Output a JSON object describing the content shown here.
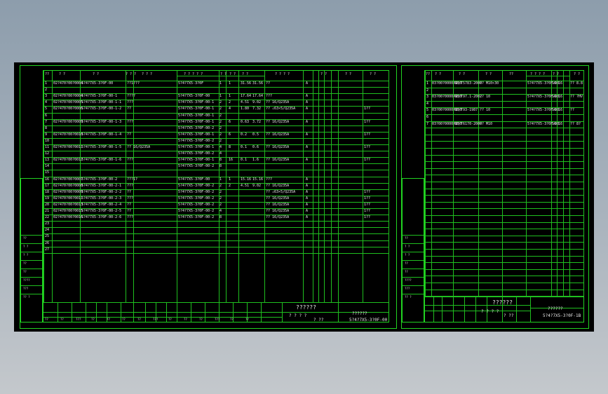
{
  "main": {
    "header": [
      "??",
      "? ?",
      "? ?",
      "? ? ?",
      "? ? ?",
      "? ? ? ? ?",
      "? ?",
      "? ?",
      "? ?",
      "? ? ? ?",
      "? ?",
      "? ?",
      "? ?"
    ],
    "subheader": [
      "? ?",
      "? ?",
      "??",
      "??",
      "??"
    ],
    "rows": [
      {
        "n": "1",
        "code": "02?470?00?0004",
        "name": "5?4?7X5-3?0F-00",
        "qty": "??1???",
        "sub": "5?4?7X5-3?0F",
        "a": "1",
        "b": "1",
        "w": "31.56",
        "tw": "31.56",
        "mat": "??",
        "z": "A",
        "r": ""
      },
      {
        "n": "2",
        "code": "",
        "name": "",
        "qty": "",
        "sub": "",
        "a": "",
        "b": "",
        "w": "",
        "tw": "",
        "mat": "",
        "z": "",
        "r": ""
      },
      {
        "n": "3",
        "code": "02?470?00?0004",
        "name": "5?4?7X5-3?0F-00-1",
        "qty": "????",
        "sub": "5?4?7X5-3?0F-00",
        "a": "1",
        "b": "1",
        "w": "17.64",
        "tw": "17.64",
        "mat": "???",
        "z": "A",
        "r": ""
      },
      {
        "n": "4",
        "code": "02?470?00?0005",
        "name": "5?4?7X5-3?0F-00-1-1",
        "qty": "???",
        "sub": "5?4?7X5-3?0F-00-1",
        "a": "2",
        "b": "2",
        "w": "4.51",
        "tw": "9.02",
        "mat": "?? 16/Q235A",
        "z": "A",
        "r": ""
      },
      {
        "n": "5",
        "code": "02?470?00?0006",
        "name": "5?4?7X5-3?0F-00-1-2",
        "qty": "??",
        "sub": "5?4?7X5-3?0F-00-1",
        "a": "2",
        "b": "4",
        "w": "1.80",
        "tw": "7.32",
        "mat": "?? ∠63×5/Q235A",
        "z": "A",
        "r": "1??"
      },
      {
        "n": "6",
        "code": "",
        "name": "",
        "qty": "",
        "sub": "5?4?7X5-3?0F-00-1",
        "a": "2",
        "b": "",
        "w": "",
        "tw": "",
        "mat": "",
        "z": "",
        "r": ""
      },
      {
        "n": "7",
        "code": "02?470?00?0009",
        "name": "5?4?7X5-3?0F-00-1-3",
        "qty": "???",
        "sub": "5?4?7X5-3?0F-00-1",
        "a": "2",
        "b": "6",
        "w": "0.63",
        "tw": "3.72",
        "mat": "?? 16/Q235A",
        "z": "A",
        "r": "1??"
      },
      {
        "n": "8",
        "code": "",
        "name": "",
        "qty": "",
        "sub": "5?4?7X5-3?0F-00-2",
        "a": "2",
        "b": "",
        "w": "",
        "tw": "",
        "mat": "",
        "z": "",
        "r": ""
      },
      {
        "n": "9",
        "code": "02?470?00?0010",
        "name": "5?4?7X5-3?0F-00-1-4",
        "qty": "??",
        "sub": "5?4?7X5-3?0F-00-1",
        "a": "2",
        "b": "6",
        "w": "0.2",
        "tw": "0.5",
        "mat": "?? 16/Q235A",
        "z": "A",
        "r": "1??"
      },
      {
        "n": "10",
        "code": "",
        "name": "",
        "qty": "",
        "sub": "5?4?7X5-3?0F-00-2",
        "a": "2",
        "b": "",
        "w": "",
        "tw": "",
        "mat": "",
        "z": "",
        "r": ""
      },
      {
        "n": "11",
        "code": "02?470?00?0011",
        "name": "5?4?7X5-3?0F-00-1-5",
        "qty": "?? 16/Q235A",
        "sub": "5?4?7X5-3?0F-00-1",
        "a": "4",
        "b": "8",
        "w": "0.1",
        "tw": "0.6",
        "mat": "?? 16/Q235A",
        "z": "A",
        "r": "1??"
      },
      {
        "n": "12",
        "code": "",
        "name": "",
        "qty": "",
        "sub": "5?4?7X5-3?0F-00-2",
        "a": "4",
        "b": "",
        "w": "",
        "tw": "",
        "mat": "",
        "z": "",
        "r": ""
      },
      {
        "n": "13",
        "code": "02?470?00?0012",
        "name": "5?4?7X5-3?0F-00-1-6",
        "qty": "???",
        "sub": "5?4?7X5-3?0F-00-1",
        "a": "8",
        "b": "16",
        "w": "0.1",
        "tw": "1.6",
        "mat": "?? 16/Q235A",
        "z": "A",
        "r": "1??"
      },
      {
        "n": "14",
        "code": "",
        "name": "",
        "qty": "",
        "sub": "5?4?7X5-3?0F-00-2",
        "a": "8",
        "b": "",
        "w": "",
        "tw": "",
        "mat": "",
        "z": "",
        "r": ""
      },
      {
        "n": "15",
        "code": "",
        "name": "",
        "qty": "",
        "sub": "",
        "a": "",
        "b": "",
        "w": "",
        "tw": "",
        "mat": "",
        "z": "",
        "r": ""
      },
      {
        "n": "16",
        "code": "02?470?00?0007",
        "name": "5?4?7X5-3?0F-00-2",
        "qty": "???1?",
        "sub": "5?4?7X5-3?0F-00",
        "a": "1",
        "b": "1",
        "w": "15.16",
        "tw": "15.16",
        "mat": "???",
        "z": "A",
        "r": ""
      },
      {
        "n": "17",
        "code": "02?470?00?0008",
        "name": "5?4?7X5-3?0F-00-2-1",
        "qty": "???",
        "sub": "5?4?7X5-3?0F-00-2",
        "a": "2",
        "b": "2",
        "w": "4.51",
        "tw": "9.02",
        "mat": "?? 16/Q235A",
        "z": "A",
        "r": ""
      },
      {
        "n": "18",
        "code": "02?470?00?0009",
        "name": "5?4?7X5-3?0F-00-2-2",
        "qty": "??",
        "sub": "5?4?7X5-3?0F-00-2",
        "a": "2",
        "b": "",
        "w": "",
        "tw": "",
        "mat": "?? ∠63×5/Q235A",
        "z": "A",
        "r": "1??"
      },
      {
        "n": "19",
        "code": "02?470?00?0011",
        "name": "5?4?7X5-3?0F-00-2-3",
        "qty": "???",
        "sub": "5?4?7X5-3?0F-00-2",
        "a": "2",
        "b": "",
        "w": "",
        "tw": "",
        "mat": "?? 16/Q235A",
        "z": "A",
        "r": "1??"
      },
      {
        "n": "20",
        "code": "02?470?00?0013",
        "name": "5?4?7X5-3?0F-00-2-4",
        "qty": "??",
        "sub": "5?4?7X5-3?0F-00-2",
        "a": "2",
        "b": "",
        "w": "",
        "tw": "",
        "mat": "?? 16/Q235A",
        "z": "A",
        "r": "1??"
      },
      {
        "n": "21",
        "code": "02?470?00?0015",
        "name": "5?4?7X5-3?0F-00-2-5",
        "qty": "??",
        "sub": "5?4?7X5-3?0F-00-2",
        "a": "4",
        "b": "",
        "w": "",
        "tw": "",
        "mat": "?? 16/Q235A",
        "z": "A",
        "r": "1??"
      },
      {
        "n": "22",
        "code": "02?470?00?0016",
        "name": "5?4?7X5-3?0F-00-2-6",
        "qty": "???",
        "sub": "5?4?7X5-3?0F-00-2",
        "a": "8",
        "b": "",
        "w": "",
        "tw": "",
        "mat": "?? 16/Q235A",
        "z": "A",
        "r": "1??"
      },
      {
        "n": "23",
        "code": "",
        "name": "",
        "qty": "",
        "sub": "",
        "a": "",
        "b": "",
        "w": "",
        "tw": "",
        "mat": "",
        "z": "",
        "r": ""
      },
      {
        "n": "24",
        "code": "",
        "name": "",
        "qty": "",
        "sub": "",
        "a": "",
        "b": "",
        "w": "",
        "tw": "",
        "mat": "",
        "z": "",
        "r": ""
      },
      {
        "n": "25",
        "code": "",
        "name": "",
        "qty": "",
        "sub": "",
        "a": "",
        "b": "",
        "w": "",
        "tw": "",
        "mat": "",
        "z": "",
        "r": ""
      },
      {
        "n": "26",
        "code": "",
        "name": "",
        "qty": "",
        "sub": "",
        "a": "",
        "b": "",
        "w": "",
        "tw": "",
        "mat": "",
        "z": "",
        "r": ""
      },
      {
        "n": "27",
        "code": "",
        "name": "",
        "qty": "",
        "sub": "",
        "a": "",
        "b": "",
        "w": "",
        "tw": "",
        "mat": "",
        "z": "",
        "r": ""
      }
    ],
    "title_block": {
      "title": "??????",
      "sub": "? ? ? ?",
      "scale": "? ??",
      "company": "??????",
      "drawing": "5?4?7X5-3?0F-00"
    },
    "sign_labels": [
      "??",
      "??",
      "???",
      "??",
      "??",
      "??",
      "??",
      "???",
      "??",
      "??",
      "??",
      "???",
      "??",
      "??"
    ],
    "side_labels": [
      "??",
      "? ?",
      "? ?",
      "??",
      "??",
      "????",
      "???",
      "?? ?"
    ]
  },
  "right": {
    "header": [
      "??",
      "? ?",
      "? ?",
      "? ?",
      "??",
      "? ? ? ?",
      "? ?",
      "? ?"
    ],
    "rows": [
      {
        "n": "1",
        "code": "03?00?0000?0?0",
        "std": "GB/T5783-2000",
        "name": "?? M10×30",
        "sub": "5?4?7X5-3?0F-00",
        "a": "16",
        "b": "16",
        "r": "?? 8.8"
      },
      {
        "n": "2",
        "code": "",
        "std": "",
        "name": "",
        "sub": "",
        "a": "",
        "b": "",
        "r": ""
      },
      {
        "n": "3",
        "code": "03?00?0000?0?0",
        "std": "GB/T97.1-2002",
        "name": "?? 10",
        "sub": "5?4?7X5-3?0F-00",
        "a": "16",
        "b": "16",
        "r": "?? ?HV"
      },
      {
        "n": "4",
        "code": "",
        "std": "",
        "name": "",
        "sub": "",
        "a": "",
        "b": "",
        "r": ""
      },
      {
        "n": "5",
        "code": "03?00?0000?0?0",
        "std": "GB/T93-1987",
        "name": "?? 10",
        "sub": "5?4?7X5-3?0F-00",
        "a": "16",
        "b": "16",
        "r": "??"
      },
      {
        "n": "6",
        "code": "",
        "std": "",
        "name": "",
        "sub": "",
        "a": "",
        "b": "",
        "r": ""
      },
      {
        "n": "7",
        "code": "03?00?0000?0?0",
        "std": "GB/T6170-2000",
        "name": "?? M10",
        "sub": "5?4?7X5-3?0F-00",
        "a": "16",
        "b": "16",
        "r": "?? 8?"
      }
    ],
    "title_block": {
      "title": "??????",
      "sub": "? ? ? ?",
      "scale": "? ??",
      "company": "??????",
      "drawing": "5?4?7X5-3?0F-1B"
    },
    "side_labels": [
      "??",
      "? ?",
      "? ?",
      "??",
      "??",
      "????",
      "???",
      "?? ?"
    ]
  }
}
